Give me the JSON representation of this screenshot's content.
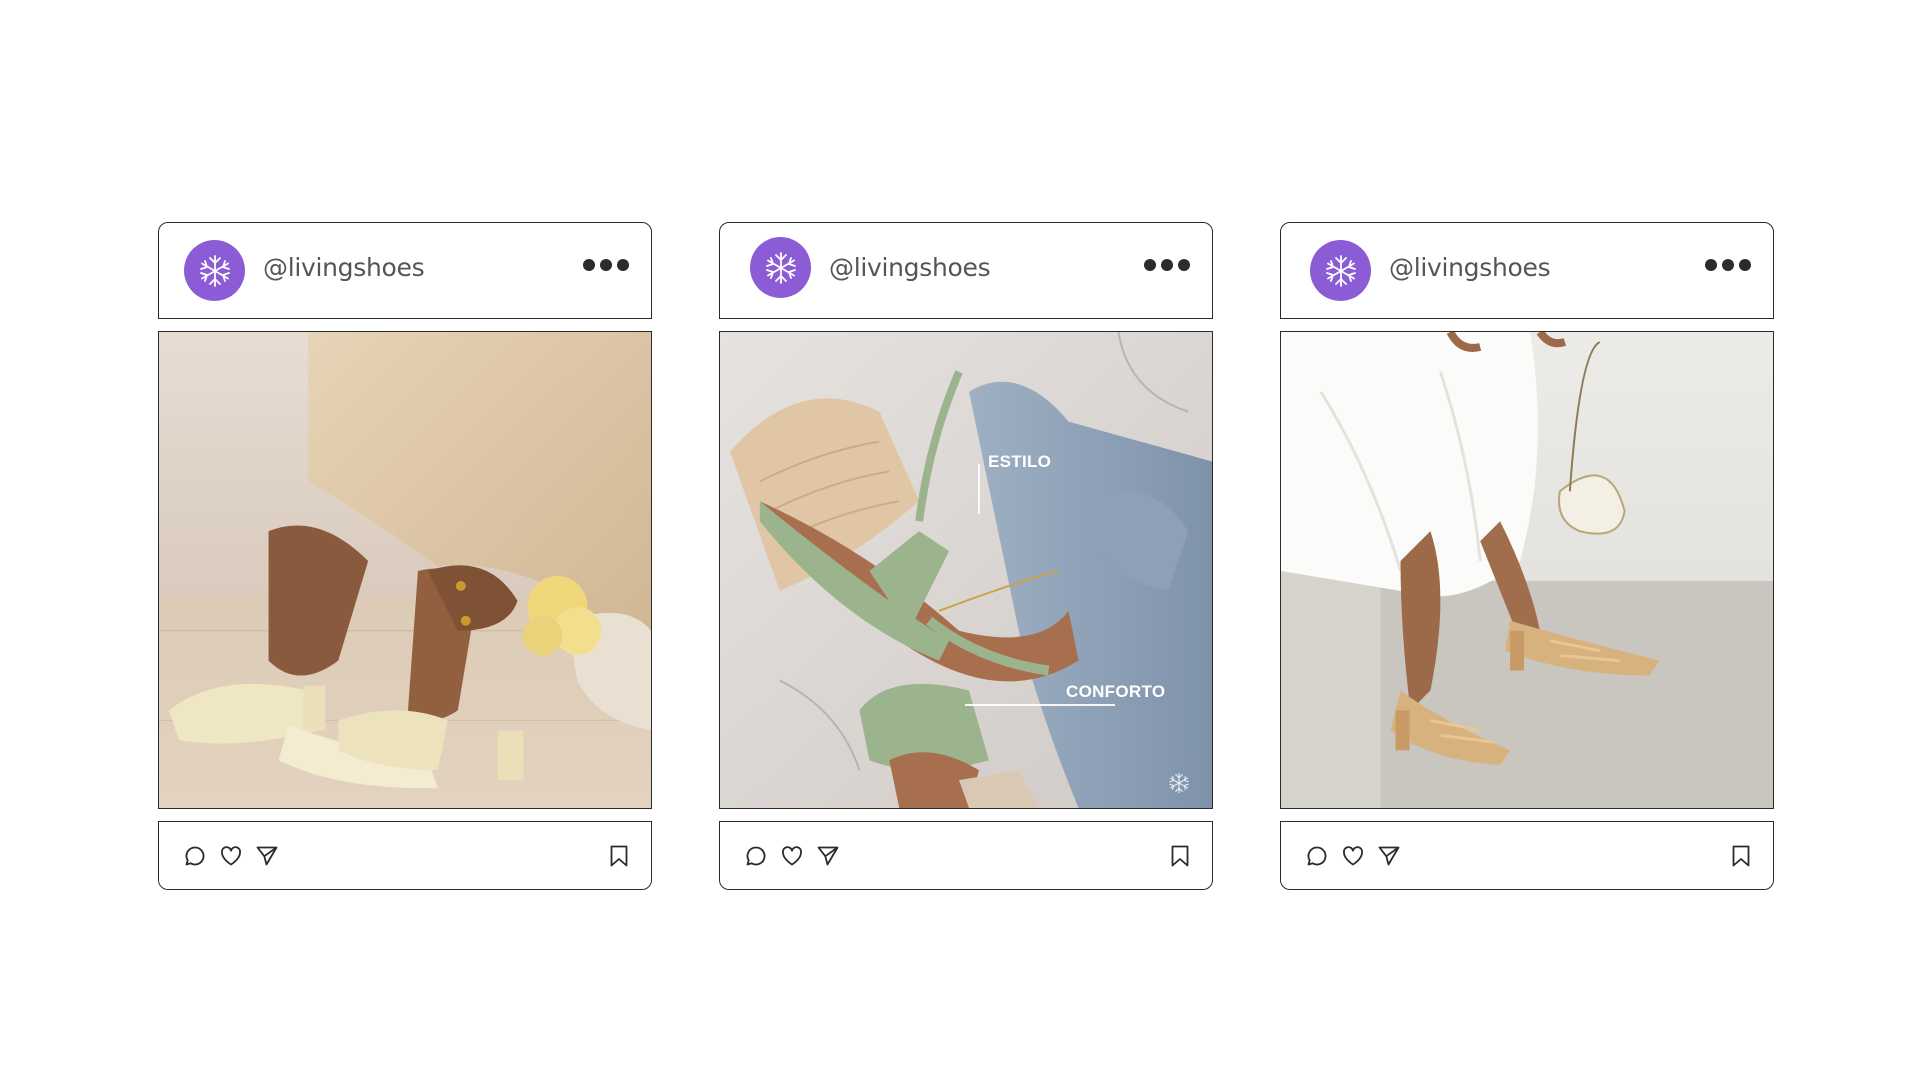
{
  "brand": {
    "accent_color": "#8B5CD6",
    "icon_color": "#2b2b2b"
  },
  "posts": [
    {
      "username": "@livingshoes",
      "avatar_icon": "snowflake-logo-icon",
      "more_icon": "more-dots-icon",
      "image_description_icon": "cream-ruched-sandals-photo",
      "actions": [
        "comment-icon",
        "heart-icon",
        "send-icon"
      ],
      "save_icon": "bookmark-icon"
    },
    {
      "username": "@livingshoes",
      "avatar_icon": "snowflake-logo-icon",
      "more_icon": "more-dots-icon",
      "image_description_icon": "sage-strappy-heel-photo",
      "overlay": {
        "label_1": "ESTILO",
        "label_2": "CONFORTO"
      },
      "actions": [
        "comment-icon",
        "heart-icon",
        "send-icon"
      ],
      "save_icon": "bookmark-icon"
    },
    {
      "username": "@livingshoes",
      "avatar_icon": "snowflake-logo-icon",
      "more_icon": "more-dots-icon",
      "image_description_icon": "gold-slingback-sandals-photo",
      "actions": [
        "comment-icon",
        "heart-icon",
        "send-icon"
      ],
      "save_icon": "bookmark-icon"
    }
  ]
}
